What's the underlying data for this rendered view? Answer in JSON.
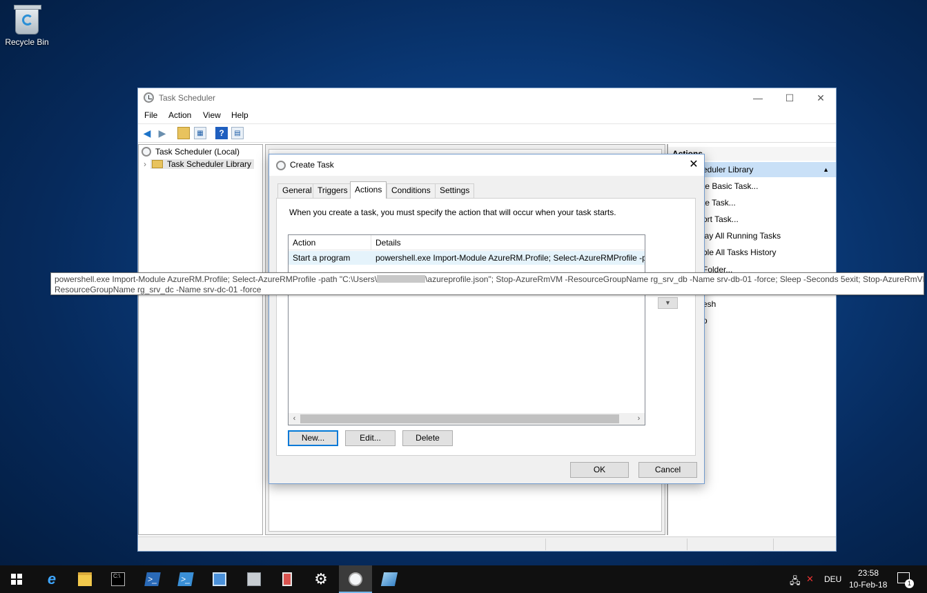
{
  "desktop": {
    "recycle_bin_label": "Recycle Bin"
  },
  "window": {
    "title": "Task Scheduler",
    "controls": {
      "minimize": "—",
      "maximize": "☐",
      "close": "✕"
    },
    "menu": [
      "File",
      "Action",
      "View",
      "Help"
    ],
    "tree": {
      "root": "Task Scheduler (Local)",
      "library": "Task Scheduler Library"
    },
    "actions_pane": {
      "header": "Actions",
      "group": "eduler Library",
      "items": [
        "te Basic Task...",
        "te Task...",
        "ort Task...",
        "lay All Running Tasks",
        "ble All Tasks History",
        "Folder...",
        "esh",
        "p"
      ]
    }
  },
  "dialog": {
    "title": "Create Task",
    "close": "✕",
    "tabs": [
      "General",
      "Triggers",
      "Actions",
      "Conditions",
      "Settings"
    ],
    "active_tab": "Actions",
    "intro": "When you create a task, you must specify the action that will occur when your task starts.",
    "columns": [
      "Action",
      "Details"
    ],
    "rows": [
      {
        "action": "Start a program",
        "details": "powershell.exe Import-Module AzureRM.Profile; Select-AzureRMProfile -p"
      }
    ],
    "buttons": {
      "new": "New...",
      "edit": "Edit...",
      "delete": "Delete",
      "ok": "OK",
      "cancel": "Cancel"
    }
  },
  "tooltip": {
    "part1": "powershell.exe Import-Module AzureRM.Profile; Select-AzureRMProfile -path \"C:\\Users\\",
    "part2": "\\azureprofile.json\"; Stop-AzureRmVM -ResourceGroupName rg_srv_db -Name srv-db-01 -force; Sleep -Seconds 5exit; Stop-AzureRmVM -",
    "line2": "ResourceGroupName rg_srv_dc -Name srv-dc-01 -force"
  },
  "taskbar": {
    "language": "DEU",
    "time": "23:58",
    "date": "10-Feb-18",
    "notification_count": "1"
  },
  "colors": {
    "accent": "#0078d7",
    "selection": "#c9e0f7",
    "taskbar": "#101010"
  }
}
